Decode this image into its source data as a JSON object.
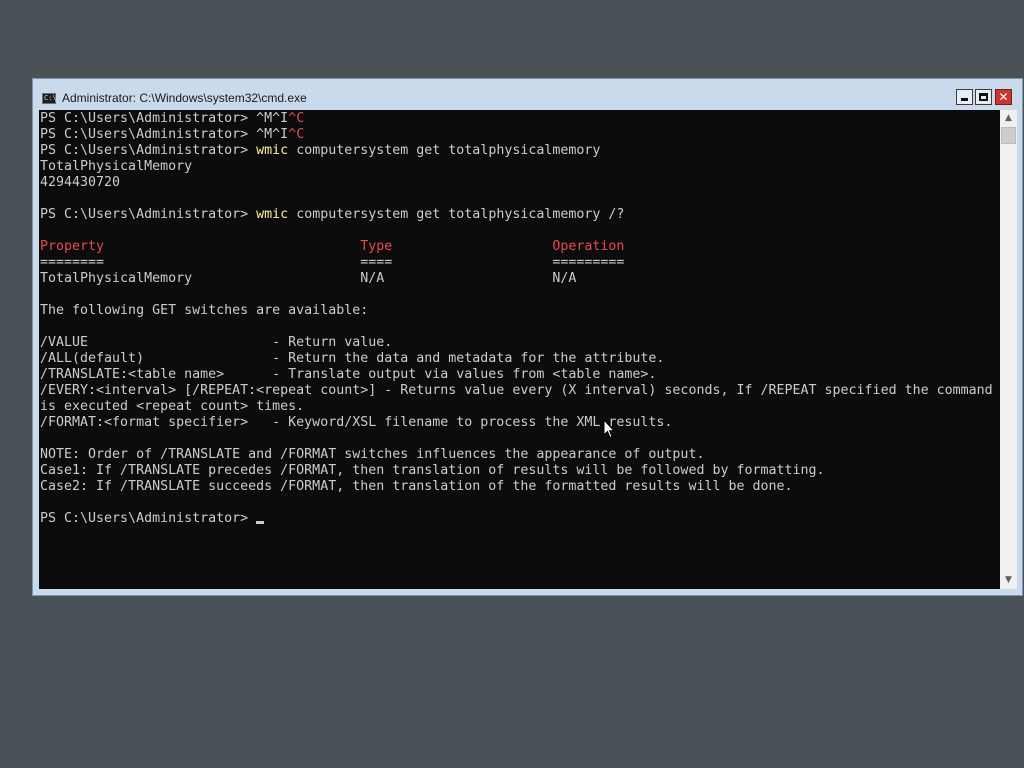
{
  "window": {
    "title": "Administrator: C:\\Windows\\system32\\cmd.exe",
    "icon": "cmd-console-icon",
    "icon_text": "C:\\",
    "controls": {
      "minimize": "minimize-icon",
      "maximize": "maximize-icon",
      "close": "close-icon",
      "close_glyph": "✕"
    }
  },
  "console": {
    "colors": {
      "background": "#0c0c0c",
      "text": "#cccccc",
      "command": "#f9f1a5",
      "red": "#e74856"
    },
    "prompt": "PS C:\\Users\\Administrator>",
    "lines": {
      "l1_prompt": "PS C:\\Users\\Administrator> ",
      "l1_ctrl_a": "^M^I",
      "l1_ctrl_b": "^C",
      "l2_prompt": "PS C:\\Users\\Administrator> ",
      "l2_ctrl_a": "^M^I",
      "l2_ctrl_b": "^C",
      "l3_prompt": "PS C:\\Users\\Administrator> ",
      "l3_cmd": "wmic",
      "l3_args": " computersystem get totalphysicalmemory",
      "l4": "TotalPhysicalMemory",
      "l5": "4294430720",
      "l7_prompt": "PS C:\\Users\\Administrator> ",
      "l7_cmd": "wmic",
      "l7_args": " computersystem get totalphysicalmemory /?",
      "hdr_property": "Property",
      "hdr_gap1": "                                ",
      "hdr_type": "Type",
      "hdr_gap2": "                    ",
      "hdr_operation": "Operation",
      "sep": "========                                ====                    =========",
      "row": "TotalPhysicalMemory                     N/A                     N/A",
      "switches_intro": "The following GET switches are available:",
      "sw_value": "/VALUE                       - Return value.",
      "sw_all": "/ALL(default)                - Return the data and metadata for the attribute.",
      "sw_translate": "/TRANSLATE:<table name>      - Translate output via values from <table name>.",
      "sw_every": "/EVERY:<interval> [/REPEAT:<repeat count>] - Returns value every (X interval) seconds, If /REPEAT specified the command",
      "sw_every_cont": "is executed <repeat count> times.",
      "sw_format": "/FORMAT:<format specifier>   - Keyword/XSL filename to process the XML results.",
      "note": "NOTE: Order of /TRANSLATE and /FORMAT switches influences the appearance of output.",
      "case1": "Case1: If /TRANSLATE precedes /FORMAT, then translation of results will be followed by formatting.",
      "case2": "Case2: If /TRANSLATE succeeds /FORMAT, then translation of the formatted results will be done.",
      "final_prompt": "PS C:\\Users\\Administrator> "
    }
  },
  "scrollbar": {
    "up_icon": "scroll-up-arrow-icon",
    "down_icon": "scroll-down-arrow-icon",
    "up_glyph": "▲",
    "down_glyph": "▼"
  },
  "pointer": {
    "icon": "mouse-pointer-icon"
  }
}
